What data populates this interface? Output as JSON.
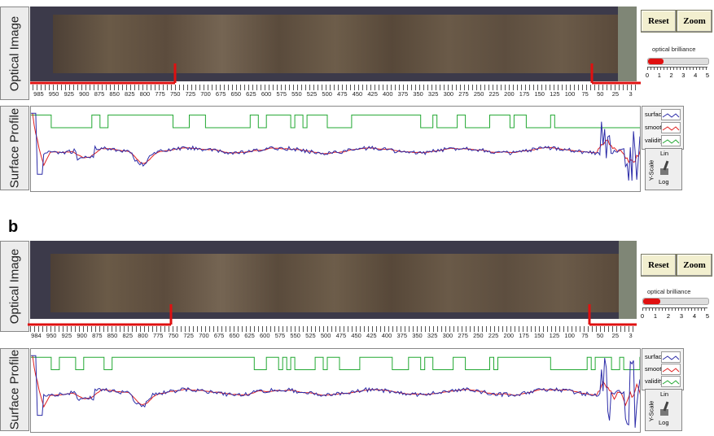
{
  "section_b_label": "b",
  "panels": [
    {
      "id": "a",
      "optical_label": "Optical Image",
      "profile_label": "Surface Profile",
      "reset_label": "Reset",
      "zoom_label": "Zoom",
      "brilliance_label": "optical brilliance",
      "brilliance_value": 1.3,
      "brilliance_ticks": [
        "0",
        "1",
        "2",
        "3",
        "4",
        "5"
      ],
      "ruler_ticks": [
        "985",
        "950",
        "925",
        "900",
        "875",
        "850",
        "825",
        "800",
        "775",
        "750",
        "725",
        "700",
        "675",
        "650",
        "625",
        "600",
        "575",
        "550",
        "525",
        "500",
        "475",
        "450",
        "425",
        "400",
        "375",
        "350",
        "325",
        "300",
        "275",
        "250",
        "225",
        "200",
        "175",
        "150",
        "125",
        "100",
        "75",
        "50",
        "25",
        "3"
      ],
      "legend": [
        "surface",
        "smoothed",
        "validity"
      ],
      "yscale_top": "Lin",
      "yscale_axis": "Y-Scale",
      "yscale_bottom": "Log"
    },
    {
      "id": "b",
      "optical_label": "Optical Image",
      "profile_label": "Surface Profile",
      "reset_label": "Reset",
      "zoom_label": "Zoom",
      "brilliance_label": "optical brilliance",
      "brilliance_value": 1.3,
      "brilliance_ticks": [
        "0",
        "1",
        "2",
        "3",
        "4",
        "5"
      ],
      "ruler_ticks": [
        "984",
        "950",
        "925",
        "900",
        "875",
        "850",
        "825",
        "800",
        "775",
        "750",
        "725",
        "700",
        "675",
        "650",
        "625",
        "600",
        "575",
        "550",
        "525",
        "500",
        "475",
        "450",
        "425",
        "400",
        "375",
        "350",
        "325",
        "300",
        "275",
        "250",
        "225",
        "200",
        "175",
        "150",
        "125",
        "100",
        "75",
        "50",
        "25",
        "3"
      ],
      "legend": [
        "surface",
        "smoothed",
        "validity"
      ],
      "yscale_top": "Lin",
      "yscale_axis": "Y-Scale",
      "yscale_bottom": "Log"
    }
  ],
  "colors": {
    "surface": "#2c2ca8",
    "smoothed": "#e02020",
    "validity": "#22a832",
    "marker": "#e01010"
  }
}
